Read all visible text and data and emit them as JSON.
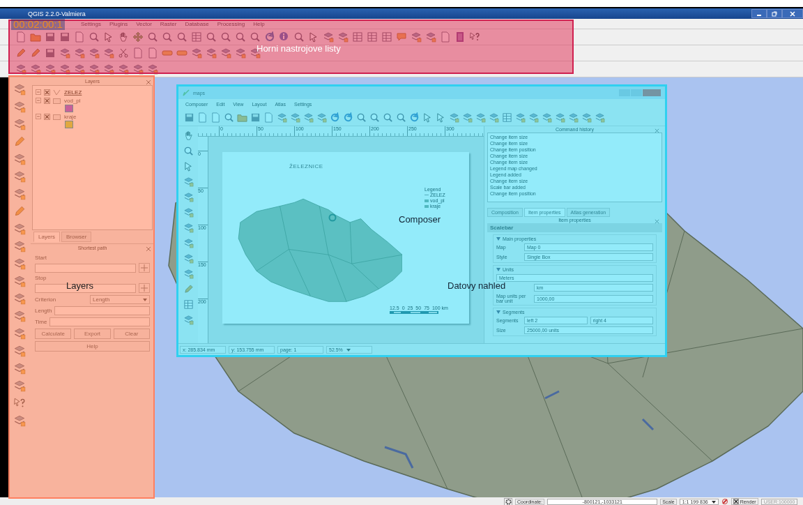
{
  "window": {
    "title": "QGIS 2.2.0-Valmiera"
  },
  "video_timestamp": "00:02:00:1",
  "menu": [
    "Settings",
    "Plugins",
    "Vector",
    "Raster",
    "Database",
    "Processing",
    "Help"
  ],
  "annotations": [
    {
      "kind": "toolbars",
      "label": "Horni nastrojove listy"
    },
    {
      "kind": "layers",
      "label": "Layers"
    },
    {
      "kind": "composer",
      "label": "Composer"
    },
    {
      "kind": "preview",
      "label": "Datovy nahled"
    }
  ],
  "layers_panel": {
    "title": "Layers",
    "layers": [
      {
        "name": "ZELEZ",
        "visible": true,
        "expanded": true,
        "selected": true
      },
      {
        "name": "vod_pl",
        "visible": true,
        "expanded": true,
        "selected": false,
        "color": "#c8609a"
      },
      {
        "name": "kraje",
        "visible": true,
        "expanded": true,
        "selected": false,
        "color": "#e0a840"
      }
    ],
    "tabs": [
      {
        "label": "Layers",
        "selected": true
      },
      {
        "label": "Browser",
        "selected": false
      }
    ]
  },
  "shortest_path": {
    "title": "Shortest path",
    "start_label": "Start",
    "stop_label": "Stop",
    "criterion_label": "Criterion",
    "criterion_value": "Length",
    "length_label": "Length",
    "time_label": "Time",
    "buttons": [
      "Calculate",
      "Export",
      "Clear"
    ],
    "help_button": "Help"
  },
  "composer": {
    "title": "maps",
    "menu": [
      "Composer",
      "Edit",
      "View",
      "Layout",
      "Atlas",
      "Settings"
    ],
    "ruler_ticks": [
      "0",
      "50",
      "100",
      "150",
      "200",
      "250",
      "300"
    ],
    "vruler_ticks": [
      "0",
      "50",
      "100",
      "150",
      "200"
    ],
    "page_title": "ŽELEZNICE",
    "legend": {
      "title": "Legend",
      "items": [
        "ZELEZ",
        "vod_pl",
        "kraje"
      ]
    },
    "scalebar_labels": [
      "12.5",
      "0",
      "25",
      "50",
      "75",
      "100 km"
    ],
    "command_history": {
      "title": "Command history",
      "entries": [
        "Change item size",
        "Change item size",
        "Change item position",
        "Change item size",
        "Change item size",
        "Legend map changed",
        "Legend added",
        "Change item size",
        "Scale bar added",
        "Change item position"
      ]
    },
    "tabs": [
      {
        "label": "Composition",
        "selected": false
      },
      {
        "label": "Item properties",
        "selected": true
      },
      {
        "label": "Atlas generation",
        "selected": false
      }
    ],
    "item_properties": {
      "title": "Item properties",
      "section": "Scalebar",
      "main_properties": {
        "title": "Main properties",
        "map_label": "Map",
        "map_value": "Map 0",
        "style_label": "Style",
        "style_value": "Single Box"
      },
      "units": {
        "title": "Units",
        "unit_value": "Meters",
        "label_value": "km",
        "per_unit_label": "Map units per bar unit",
        "per_unit_value": "1000,00"
      },
      "segments": {
        "title": "Segments",
        "segments_label": "Segments",
        "left_value": "left 2",
        "right_value": "right 4",
        "size_label": "Size",
        "size_value": "25000,00 units"
      }
    },
    "status": {
      "x": "x: 285.834 mm",
      "y": "y: 153.755 mm",
      "page": "page: 1",
      "zoom": "52.5%"
    }
  },
  "status_bar": {
    "coordinate_label": "Coordinate:",
    "coordinate_value": "-800121,-1033121",
    "scale_label": "Scale",
    "scale_value": "1:1 199 836",
    "render_label": "Render",
    "render_checked": true,
    "crs": "USER:100000"
  }
}
